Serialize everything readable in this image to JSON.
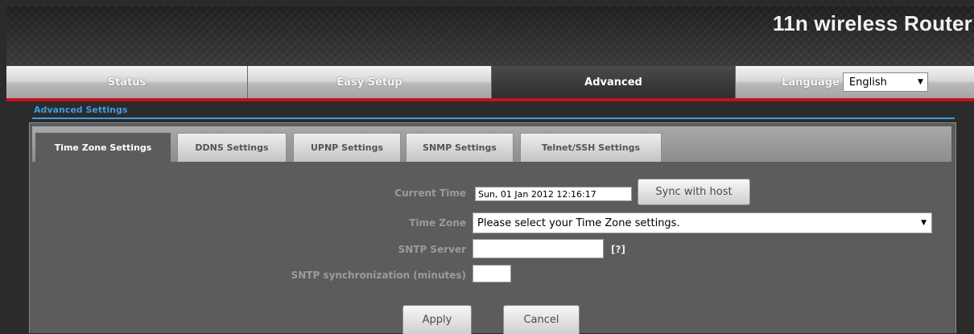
{
  "header": {
    "brand": "11n wireless Router"
  },
  "nav": {
    "tabs": [
      {
        "label": "Status",
        "active": false
      },
      {
        "label": "Easy Setup",
        "active": false
      },
      {
        "label": "Advanced",
        "active": true
      }
    ],
    "language_label": "Language",
    "language_value": "English"
  },
  "section_title": "Advanced Settings",
  "subtabs": [
    {
      "label": "Time Zone Settings",
      "active": true
    },
    {
      "label": "DDNS Settings",
      "active": false
    },
    {
      "label": "UPNP Settings",
      "active": false
    },
    {
      "label": "SNMP Settings",
      "active": false
    },
    {
      "label": "Telnet/SSH Settings",
      "active": false
    }
  ],
  "form": {
    "current_time_label": "Current Time",
    "current_time_value": "Sun, 01 Jan 2012 12:16:17",
    "sync_button": "Sync with host",
    "time_zone_label": "Time Zone",
    "time_zone_value": "Please select your Time Zone settings.",
    "sntp_server_label": "SNTP Server",
    "sntp_server_value": "",
    "help_link": "[?]",
    "sntp_sync_label": "SNTP synchronization (minutes)",
    "sntp_sync_value": "",
    "apply_button": "Apply",
    "cancel_button": "Cancel"
  },
  "colors": {
    "accent_red": "#c3121c",
    "section_blue": "#3f9be0",
    "panel_bg": "#5c5c5c"
  },
  "icons": {
    "dropdown": "chevron-down-icon"
  }
}
